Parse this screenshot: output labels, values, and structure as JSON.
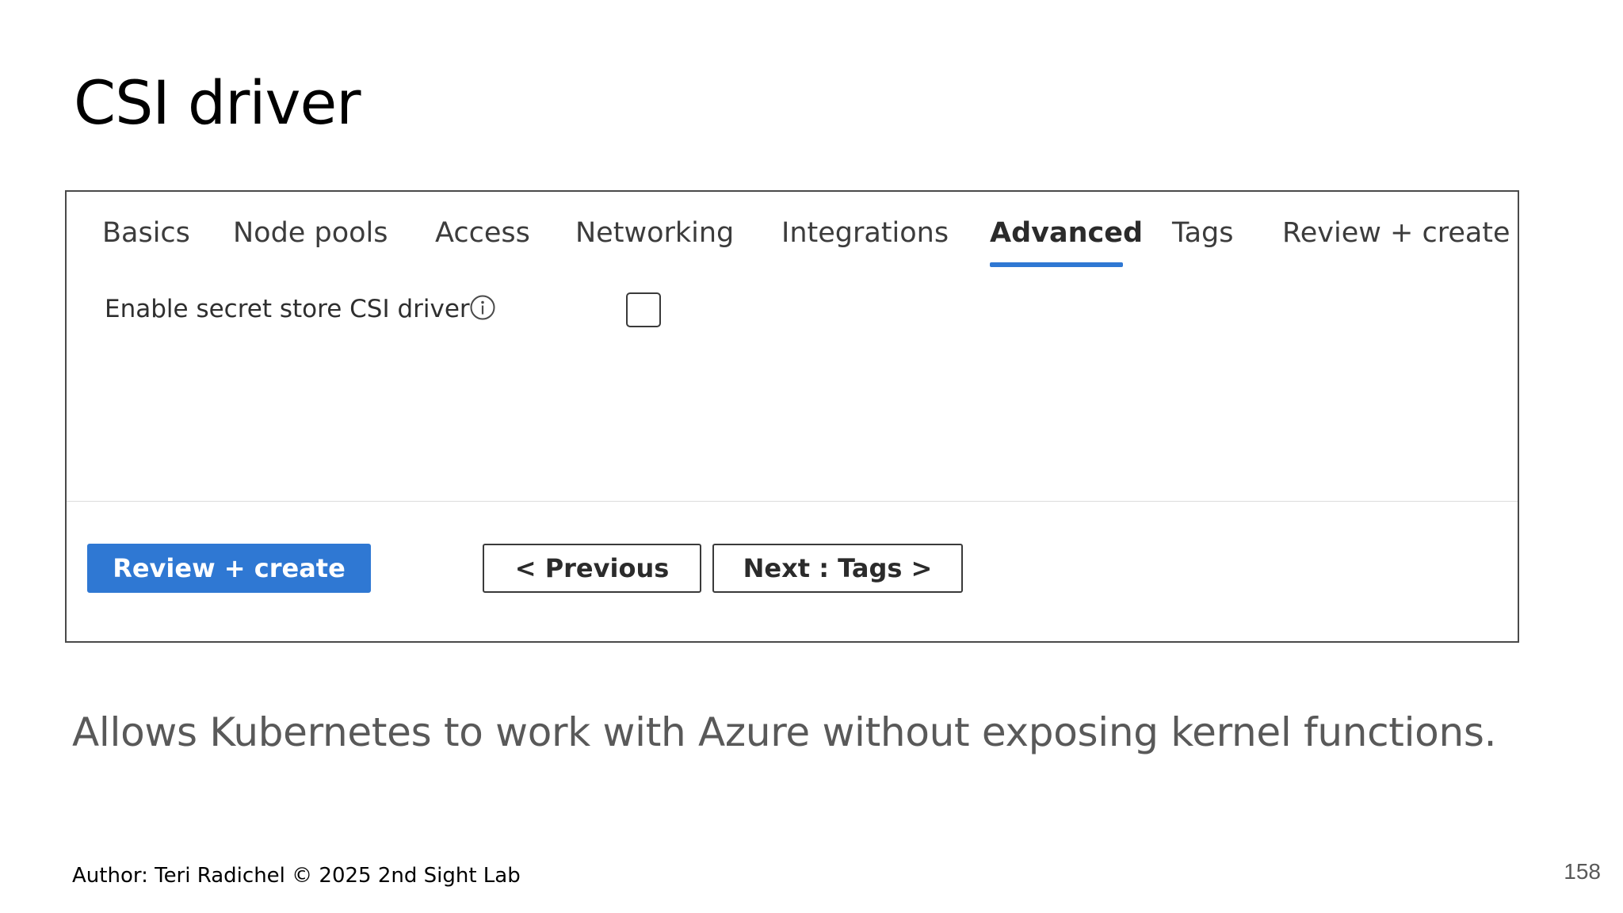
{
  "slide": {
    "title": "CSI driver",
    "description": "Allows Kubernetes to work with Azure without exposing kernel functions.",
    "footer_author": "Author: Teri Radichel © 2025 2nd Sight Lab",
    "page_number": "158"
  },
  "portal": {
    "tabs": [
      {
        "label": "Basics",
        "active": false
      },
      {
        "label": "Node pools",
        "active": false
      },
      {
        "label": "Access",
        "active": false
      },
      {
        "label": "Networking",
        "active": false
      },
      {
        "label": "Integrations",
        "active": false
      },
      {
        "label": "Advanced",
        "active": true
      },
      {
        "label": "Tags",
        "active": false
      },
      {
        "label": "Review + create",
        "active": false
      }
    ],
    "field": {
      "label": "Enable secret store CSI driver",
      "info_icon": "info-icon",
      "checked": false
    },
    "buttons": {
      "review_create": "Review + create",
      "previous": "< Previous",
      "next": "Next : Tags >"
    },
    "colors": {
      "accent": "#2f78d3",
      "tab_text": "#3c3c3c",
      "frame_border": "#4a4a4a"
    }
  }
}
